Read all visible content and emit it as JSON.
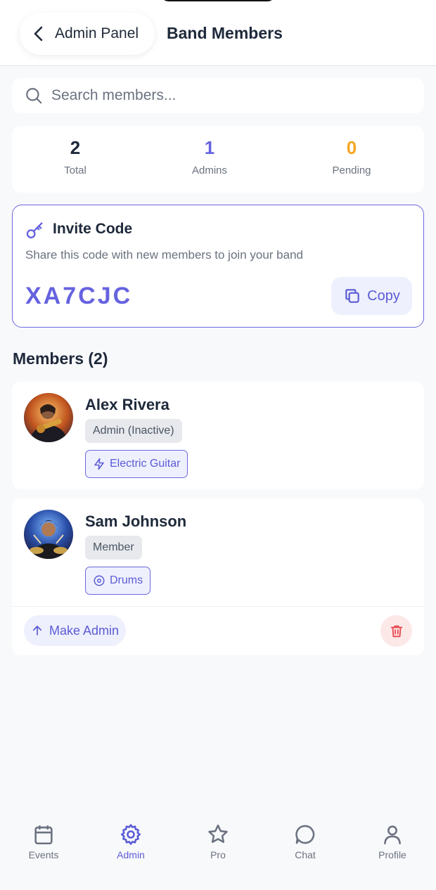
{
  "header": {
    "back_label": "Admin Panel",
    "title": "Band Members"
  },
  "search": {
    "placeholder": "Search members...",
    "value": ""
  },
  "stats": [
    {
      "value": "2",
      "label": "Total",
      "color": "#1e293b"
    },
    {
      "value": "1",
      "label": "Admins",
      "color": "#6663e0"
    },
    {
      "value": "0",
      "label": "Pending",
      "color": "#f5a623"
    }
  ],
  "invite": {
    "title": "Invite Code",
    "description": "Share this code with new members to join your band",
    "code": "XA7CJC",
    "copy_label": "Copy",
    "icon": "key-icon"
  },
  "members_heading": "Members (2)",
  "members": [
    {
      "name": "Alex Rivera",
      "role": "Admin (Inactive)",
      "instrument": "Electric Guitar",
      "instrument_icon": "lightning-icon"
    },
    {
      "name": "Sam Johnson",
      "role": "Member",
      "instrument": "Drums",
      "instrument_icon": "drum-icon",
      "make_admin_label": "Make Admin"
    }
  ],
  "nav": [
    {
      "label": "Events",
      "icon": "calendar-icon",
      "active": false
    },
    {
      "label": "Admin",
      "icon": "gear-icon",
      "active": true
    },
    {
      "label": "Pro",
      "icon": "star-icon",
      "active": false
    },
    {
      "label": "Chat",
      "icon": "chat-icon",
      "active": false
    },
    {
      "label": "Profile",
      "icon": "user-icon",
      "active": false
    }
  ],
  "colors": {
    "accent": "#5b5bd6",
    "admins_stat": "#6663e0",
    "pending_stat": "#f5a623",
    "danger": "#e5484d"
  }
}
